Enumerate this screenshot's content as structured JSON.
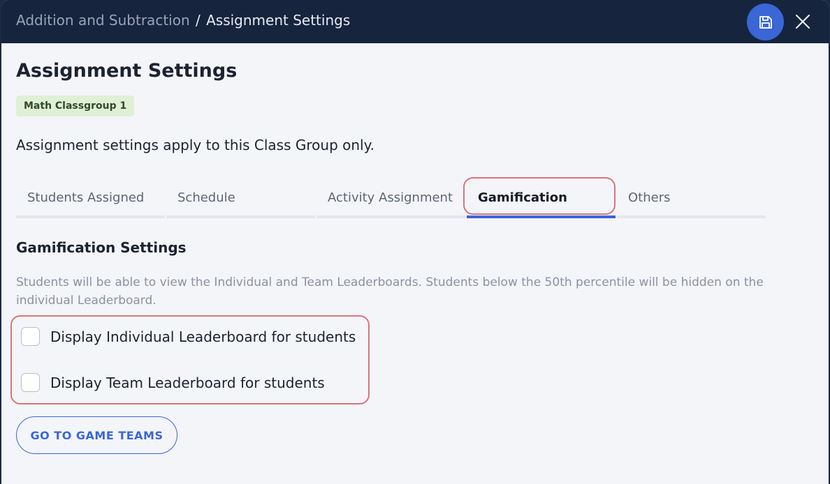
{
  "window": {
    "breadcrumb_parent": "Addition and Subtraction",
    "breadcrumb_separator": "/",
    "breadcrumb_current": "Assignment Settings",
    "save_icon": "save-icon",
    "close_icon": "close-icon"
  },
  "page": {
    "title": "Assignment Settings",
    "class_group_badge": "Math Classgroup 1",
    "description": "Assignment settings apply to this Class Group only."
  },
  "tabs": [
    {
      "label": "Students Assigned",
      "active": false
    },
    {
      "label": "Schedule",
      "active": false
    },
    {
      "label": "Activity Assignment",
      "active": false
    },
    {
      "label": "Gamification",
      "active": true
    },
    {
      "label": "Others",
      "active": false
    }
  ],
  "gamification": {
    "title": "Gamification Settings",
    "description": "Students will be able to view the Individual and Team Leaderboards. Students below the 50th percentile will be hidden on the individual Leaderboard.",
    "options": [
      {
        "label": "Display Individual Leaderboard for students",
        "checked": false
      },
      {
        "label": "Display Team Leaderboard for students",
        "checked": false
      }
    ],
    "game_teams_button": "GO TO GAME TEAMS"
  },
  "colors": {
    "header_bg": "#16243d",
    "accent": "#3a66d6",
    "highlight": "#d9757a",
    "badge_bg": "#dff0d6"
  }
}
